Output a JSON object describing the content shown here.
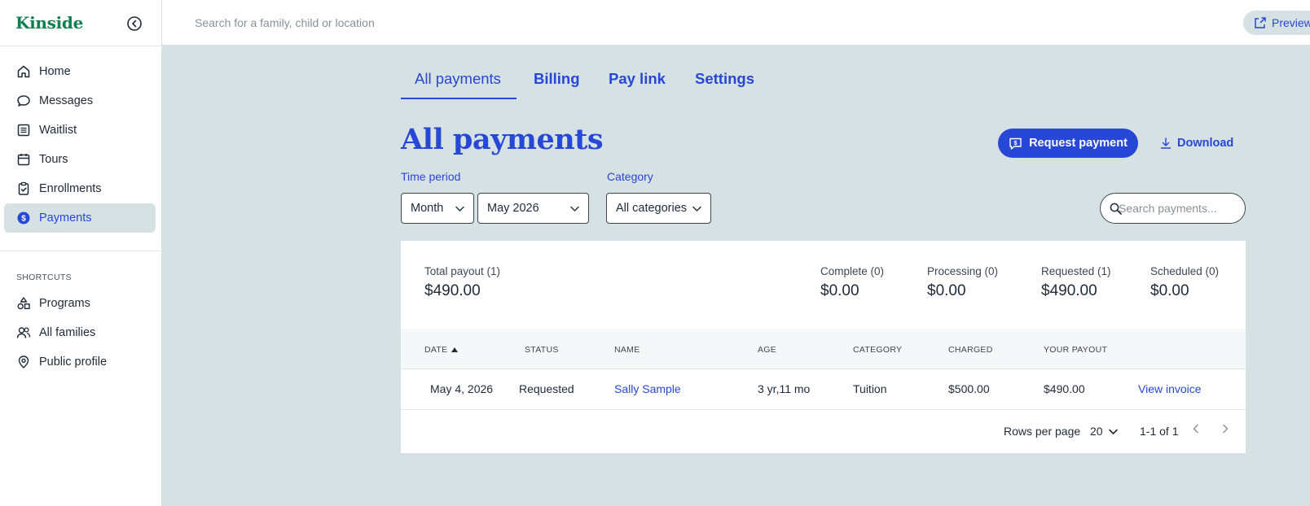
{
  "sidebar": {
    "brand": "Kinside",
    "items": [
      {
        "label": "Home",
        "icon": "home-icon"
      },
      {
        "label": "Messages",
        "icon": "chat-icon"
      },
      {
        "label": "Waitlist",
        "icon": "list-icon"
      },
      {
        "label": "Tours",
        "icon": "calendar-icon"
      },
      {
        "label": "Enrollments",
        "icon": "clipboard-check-icon"
      },
      {
        "label": "Payments",
        "icon": "dollar-icon",
        "active": true
      }
    ],
    "shortcuts_heading": "SHORTCUTS",
    "shortcuts": [
      {
        "label": "Programs",
        "icon": "shapes-icon"
      },
      {
        "label": "All families",
        "icon": "people-icon"
      },
      {
        "label": "Public profile",
        "icon": "location-pin-icon"
      }
    ]
  },
  "topbar": {
    "search_placeholder": "Search for a family, child or location",
    "preview_label": "Preview"
  },
  "tabs": [
    {
      "label": "All payments",
      "active": true
    },
    {
      "label": "Billing"
    },
    {
      "label": "Pay link"
    },
    {
      "label": "Settings"
    }
  ],
  "page": {
    "title": "All payments",
    "request_payment_label": "Request payment",
    "download_label": "Download"
  },
  "filters": {
    "time_period_label": "Time period",
    "period_unit": "Month",
    "period_value": "May 2026",
    "category_label": "Category",
    "category_value": "All categories",
    "search_placeholder": "Search payments..."
  },
  "summary": {
    "total": {
      "label": "Total payout (1)",
      "value": "$490.00"
    },
    "complete": {
      "label": "Complete (0)",
      "value": "$0.00"
    },
    "processing": {
      "label": "Processing (0)",
      "value": "$0.00"
    },
    "requested": {
      "label": "Requested (1)",
      "value": "$490.00"
    },
    "scheduled": {
      "label": "Scheduled (0)",
      "value": "$0.00"
    }
  },
  "table": {
    "columns": [
      "DATE",
      "STATUS",
      "NAME",
      "AGE",
      "CATEGORY",
      "CHARGED",
      "YOUR PAYOUT"
    ],
    "rows": [
      {
        "date": "May 4, 2026",
        "status": "Requested",
        "name": "Sally Sample",
        "age": "3 yr,11 mo",
        "category": "Tuition",
        "charged": "$500.00",
        "payout": "$490.00",
        "action": "View invoice"
      }
    ]
  },
  "pagination": {
    "rows_per_page_label": "Rows per page",
    "rows_per_page": "20",
    "range": "1-1 of 1"
  },
  "colors": {
    "accent": "#2747d6",
    "brand": "#0e7f4f",
    "background": "#d5e1e2"
  }
}
